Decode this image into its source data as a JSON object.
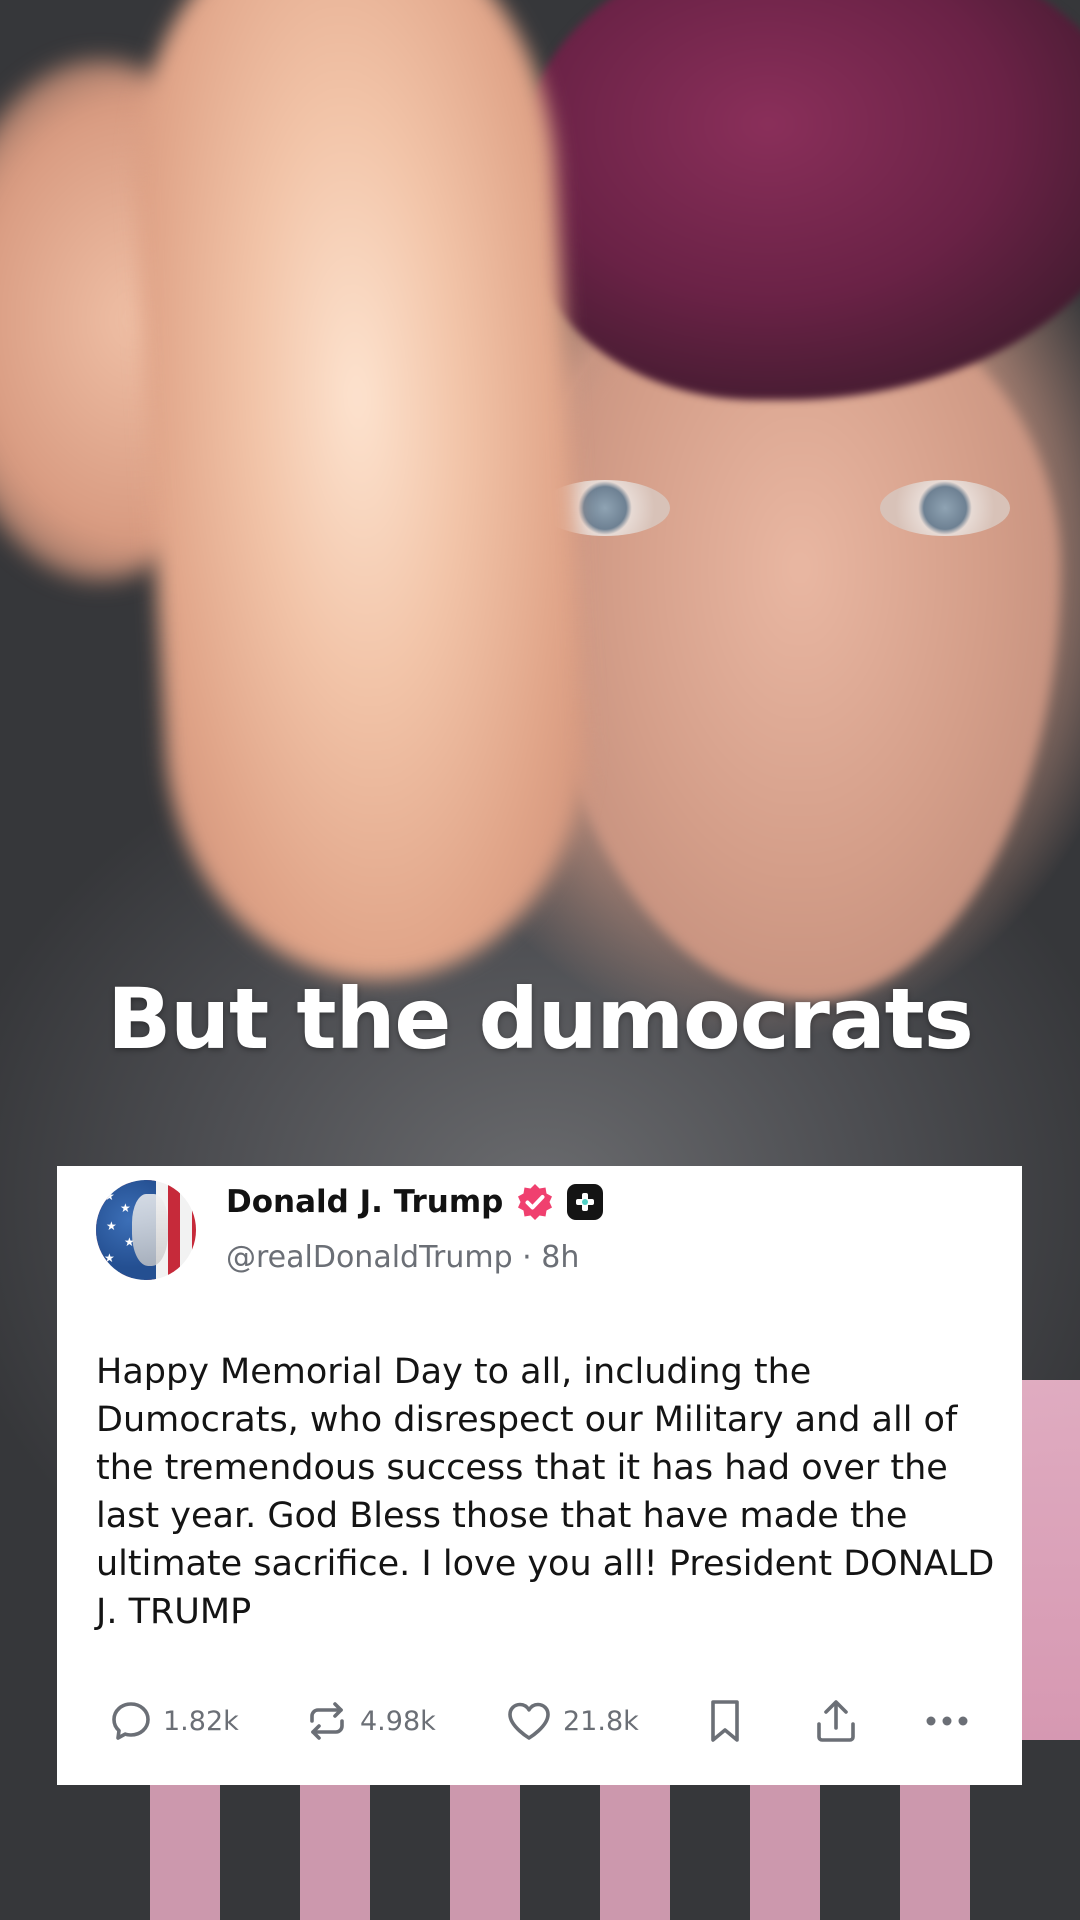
{
  "video": {
    "caption": "But the dumocrats"
  },
  "post": {
    "author": {
      "display_name": "Donald J. Trump",
      "handle": "@realDonaldTrump",
      "separator": "·",
      "time_ago": "8h",
      "verified_badge_color": "#f0406f"
    },
    "body": "Happy Memorial Day to all, including the Dumocrats, who disrespect our Military and all of the tremendous success that it has had over the last year. God Bless those that have made the ultimate sacrifice. I love you all! President DONALD J. TRUMP",
    "actions": {
      "replies": {
        "icon": "reply-icon",
        "count": "1.82k"
      },
      "retruths": {
        "icon": "repost-icon",
        "count": "4.98k"
      },
      "likes": {
        "icon": "heart-icon",
        "count": "21.8k"
      },
      "bookmark": {
        "icon": "bookmark-icon"
      },
      "share": {
        "icon": "share-icon"
      },
      "more": {
        "icon": "more-icon"
      }
    }
  },
  "colors": {
    "card_background": "#ffffff",
    "text_primary": "#121212",
    "text_secondary": "#6b6f76",
    "caption_text": "#ffffff"
  }
}
